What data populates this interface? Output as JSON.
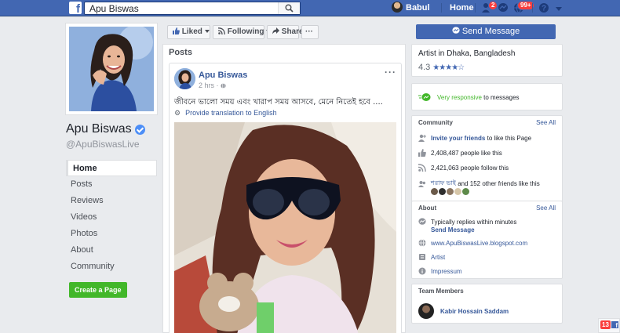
{
  "topbar": {
    "search_value": "Apu Biswas",
    "user_name": "Babul",
    "home_label": "Home",
    "friend_badge": "2",
    "notif_badge": "99+"
  },
  "profile": {
    "name": "Apu Biswas",
    "handle": "@ApuBiswasLive",
    "nav": [
      "Home",
      "Posts",
      "Reviews",
      "Videos",
      "Photos",
      "About",
      "Community"
    ],
    "create_page": "Create a Page"
  },
  "actions": {
    "liked": "Liked",
    "following": "Following",
    "share": "Share",
    "more": "···",
    "send_message": "Send Message"
  },
  "posts": {
    "heading": "Posts",
    "author": "Apu Biswas",
    "time": "2 hrs",
    "text": "জীবনে ভালো সময় এবং খারাপ সময় আসবে, মেনে নিতেই হবে ....",
    "translate": "Provide translation to English"
  },
  "right": {
    "tagline": "Artist in Dhaka, Bangladesh",
    "rating": "4.3",
    "responsive_label": "Very responsive",
    "responsive_suffix": "to messages",
    "community": {
      "title": "Community",
      "see_all": "See All",
      "invite_link": "Invite your friends",
      "invite_suffix": "to like this Page",
      "likes": "2,408,487 people like this",
      "follows": "2,421,063 people follow this",
      "friend_name": "শরাফ ভাই",
      "friend_suffix": "and 152 other friends like this"
    },
    "about": {
      "title": "About",
      "see_all": "See All",
      "reply_line": "Typically replies within minutes",
      "send_message": "Send Message",
      "website": "www.ApuBiswasLive.blogspot.com",
      "category": "Artist",
      "impressum": "Impressum"
    },
    "team": {
      "title": "Team Members",
      "member": "Kabir Hossain Saddam"
    }
  },
  "corner": {
    "count": "13"
  },
  "colors": {
    "brand": "#4267b2",
    "link": "#365899",
    "green": "#42b72a",
    "badge": "#fa3e3e"
  }
}
